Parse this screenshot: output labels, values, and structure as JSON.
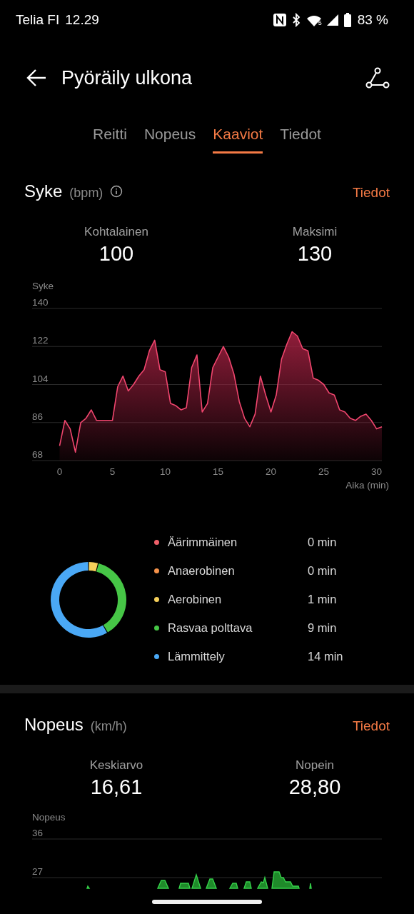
{
  "status_bar": {
    "carrier": "Telia FI",
    "time": "12.29",
    "wifi_badge": "5",
    "battery": "83 %"
  },
  "header": {
    "title": "Pyöräily ulkona"
  },
  "tabs": [
    {
      "label": "Reitti",
      "selected": false
    },
    {
      "label": "Nopeus",
      "selected": false
    },
    {
      "label": "Kaaviot",
      "selected": true
    },
    {
      "label": "Tiedot",
      "selected": false
    }
  ],
  "heart_rate": {
    "title": "Syke",
    "unit": "(bpm)",
    "details_link": "Tiedot",
    "stats": [
      {
        "label": "Kohtalainen",
        "value": "100"
      },
      {
        "label": "Maksimi",
        "value": "130"
      }
    ],
    "chart_data": {
      "type": "area",
      "ylabel": "Syke",
      "xlabel": "Aika (min)",
      "xlim": [
        -2.6,
        30.5
      ],
      "ylim": [
        68,
        140
      ],
      "grid": true,
      "xticks": [
        0,
        5,
        10,
        15,
        20,
        25,
        30
      ],
      "yticks": [
        68,
        86,
        104,
        122,
        140
      ],
      "x": [
        0,
        0.5,
        1,
        1.5,
        2,
        2.5,
        3,
        3.5,
        4,
        4.5,
        5,
        5.5,
        6,
        6.5,
        7,
        7.5,
        8,
        8.5,
        9,
        9.5,
        10,
        10.5,
        11,
        11.5,
        12,
        12.5,
        13,
        13.5,
        14,
        14.5,
        15,
        15.5,
        16,
        16.5,
        17,
        17.5,
        18,
        18.5,
        19,
        19.5,
        20,
        20.5,
        21,
        21.5,
        22,
        22.5,
        23,
        23.5,
        24,
        24.5,
        25,
        25.5,
        26,
        26.5,
        27,
        27.5,
        28,
        28.5,
        29,
        29.5,
        30,
        30.5
      ],
      "color": "#f0466e",
      "values": [
        75,
        87,
        83,
        72,
        86,
        88,
        92,
        87,
        87,
        87,
        87,
        103,
        108,
        101,
        104,
        108,
        111,
        120,
        125,
        111,
        110,
        95,
        94,
        92,
        93,
        112,
        118,
        91,
        95,
        112,
        117,
        122,
        117,
        109,
        96,
        88,
        84,
        90,
        108,
        99,
        91,
        99,
        116,
        123,
        129,
        127,
        121,
        120,
        107,
        106,
        104,
        100,
        99,
        92,
        91,
        88,
        87,
        89,
        90,
        87,
        83,
        84
      ]
    },
    "zones": {
      "chart_data": {
        "type": "donut",
        "categories": [
          "Äärimmäinen",
          "Anaerobinen",
          "Aerobinen",
          "Rasvaa polttava",
          "Lämmittely"
        ],
        "values": [
          0,
          0,
          4.17,
          37.5,
          58.33
        ]
      },
      "items": [
        {
          "duration": "0 min",
          "color": "#f0606a"
        },
        {
          "duration": "0 min",
          "color": "#f5924a"
        },
        {
          "duration": "1 min",
          "color": "#f5cf5a"
        },
        {
          "duration": "9 min",
          "color": "#46c646"
        },
        {
          "duration": "14 min",
          "color": "#4aa8f5"
        }
      ]
    }
  },
  "speed": {
    "title": "Nopeus",
    "unit": "(km/h)",
    "details_link": "Tiedot",
    "stats": [
      {
        "label": "Keskiarvo",
        "value": "16,61"
      },
      {
        "label": "Nopein",
        "value": "28,80"
      }
    ],
    "ylabel": "Nopeus",
    "yticks": [
      "36",
      "27"
    ]
  }
}
